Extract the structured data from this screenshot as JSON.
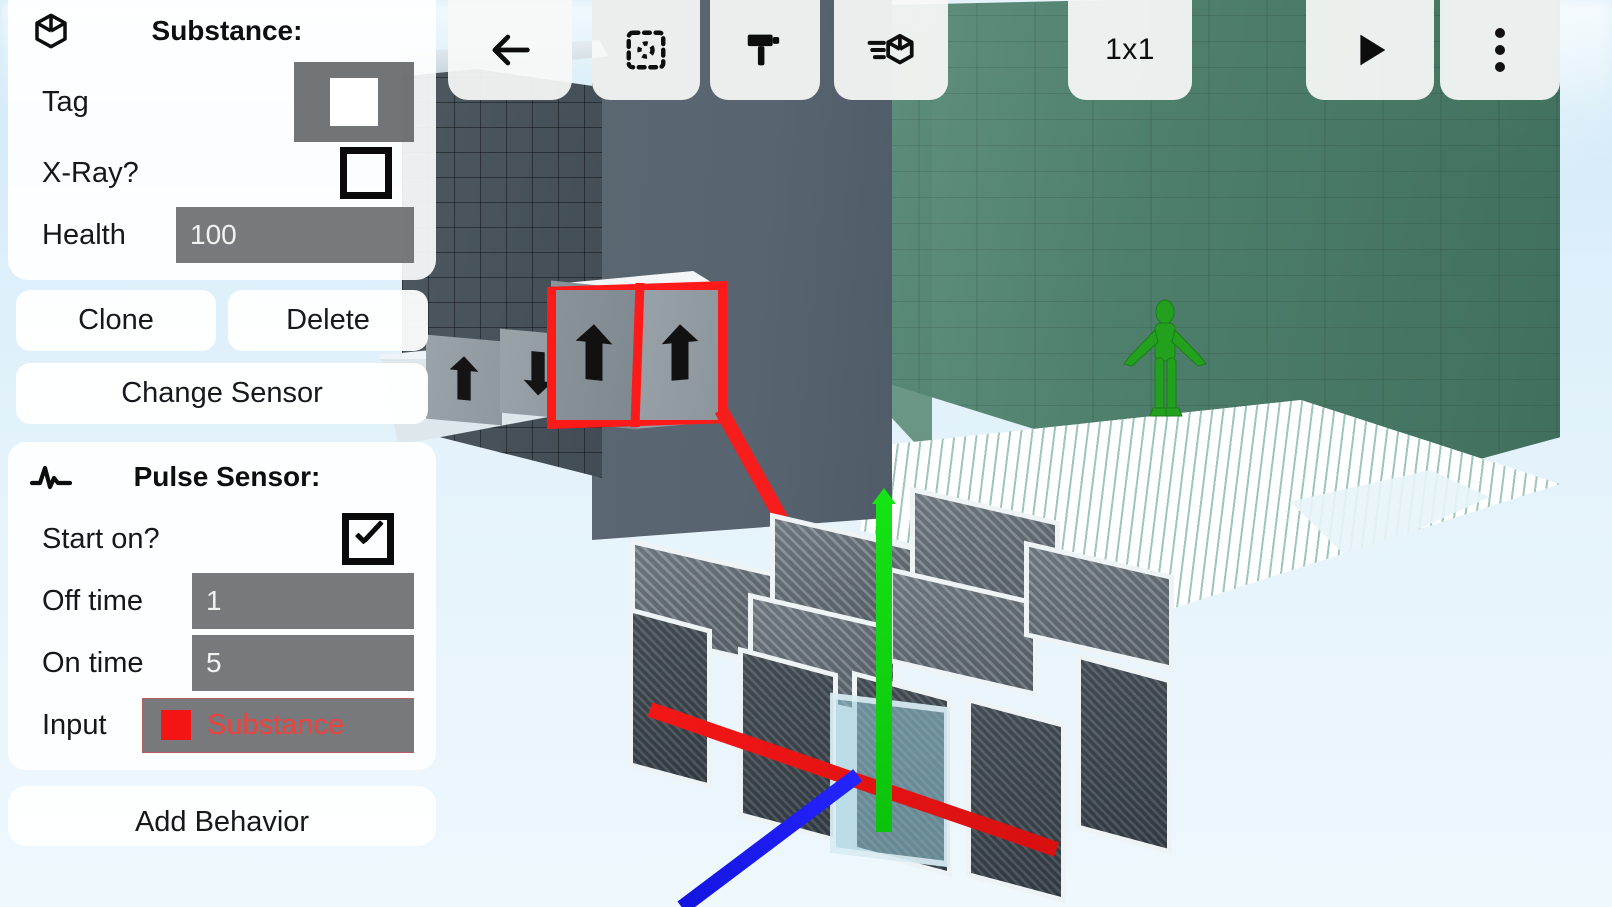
{
  "app": {
    "scene_name": "3d-block-editor-scene"
  },
  "toolbar": {
    "back_label": "",
    "back_icon": "arrow-left-icon",
    "select_icon": "select-marquee-icon",
    "paint_icon": "paint-roller-icon",
    "move_icon": "move-object-icon",
    "grid_size_label": "1x1",
    "play_icon": "play-icon",
    "menu_icon": "more-vertical-icon"
  },
  "substance_panel": {
    "icon": "cube-icon",
    "title": "Substance:",
    "rows": {
      "tag_label": "Tag",
      "tag_color": "#ffffff",
      "xray_label": "X-Ray?",
      "xray_checked": false,
      "health_label": "Health",
      "health_value": "100"
    },
    "actions": {
      "clone_label": "Clone",
      "delete_label": "Delete",
      "change_sensor_label": "Change Sensor"
    }
  },
  "pulse_panel": {
    "icon": "pulse-icon",
    "title": "Pulse Sensor:",
    "rows": {
      "start_on_label": "Start on?",
      "start_on_checked": true,
      "off_time_label": "Off time",
      "off_time_value": "1",
      "on_time_label": "On time",
      "on_time_value": "5",
      "input_label": "Input",
      "input_value": "Substance",
      "input_color": "#f41414"
    }
  },
  "add_behavior": {
    "label": "Add Behavior"
  },
  "scene": {
    "selected_block_icon": "arrow-up-block",
    "neighbor_block_icons": [
      "arrow-up-block",
      "arrow-down-block"
    ],
    "selection_color": "#ff1a1a",
    "axis_colors": {
      "x": "#f31616",
      "y": "#14e314",
      "z": "#1414e0"
    },
    "character": "green-humanoid-character",
    "arrow_up_glyph": "⬆",
    "arrow_down_glyph": "⬇"
  }
}
